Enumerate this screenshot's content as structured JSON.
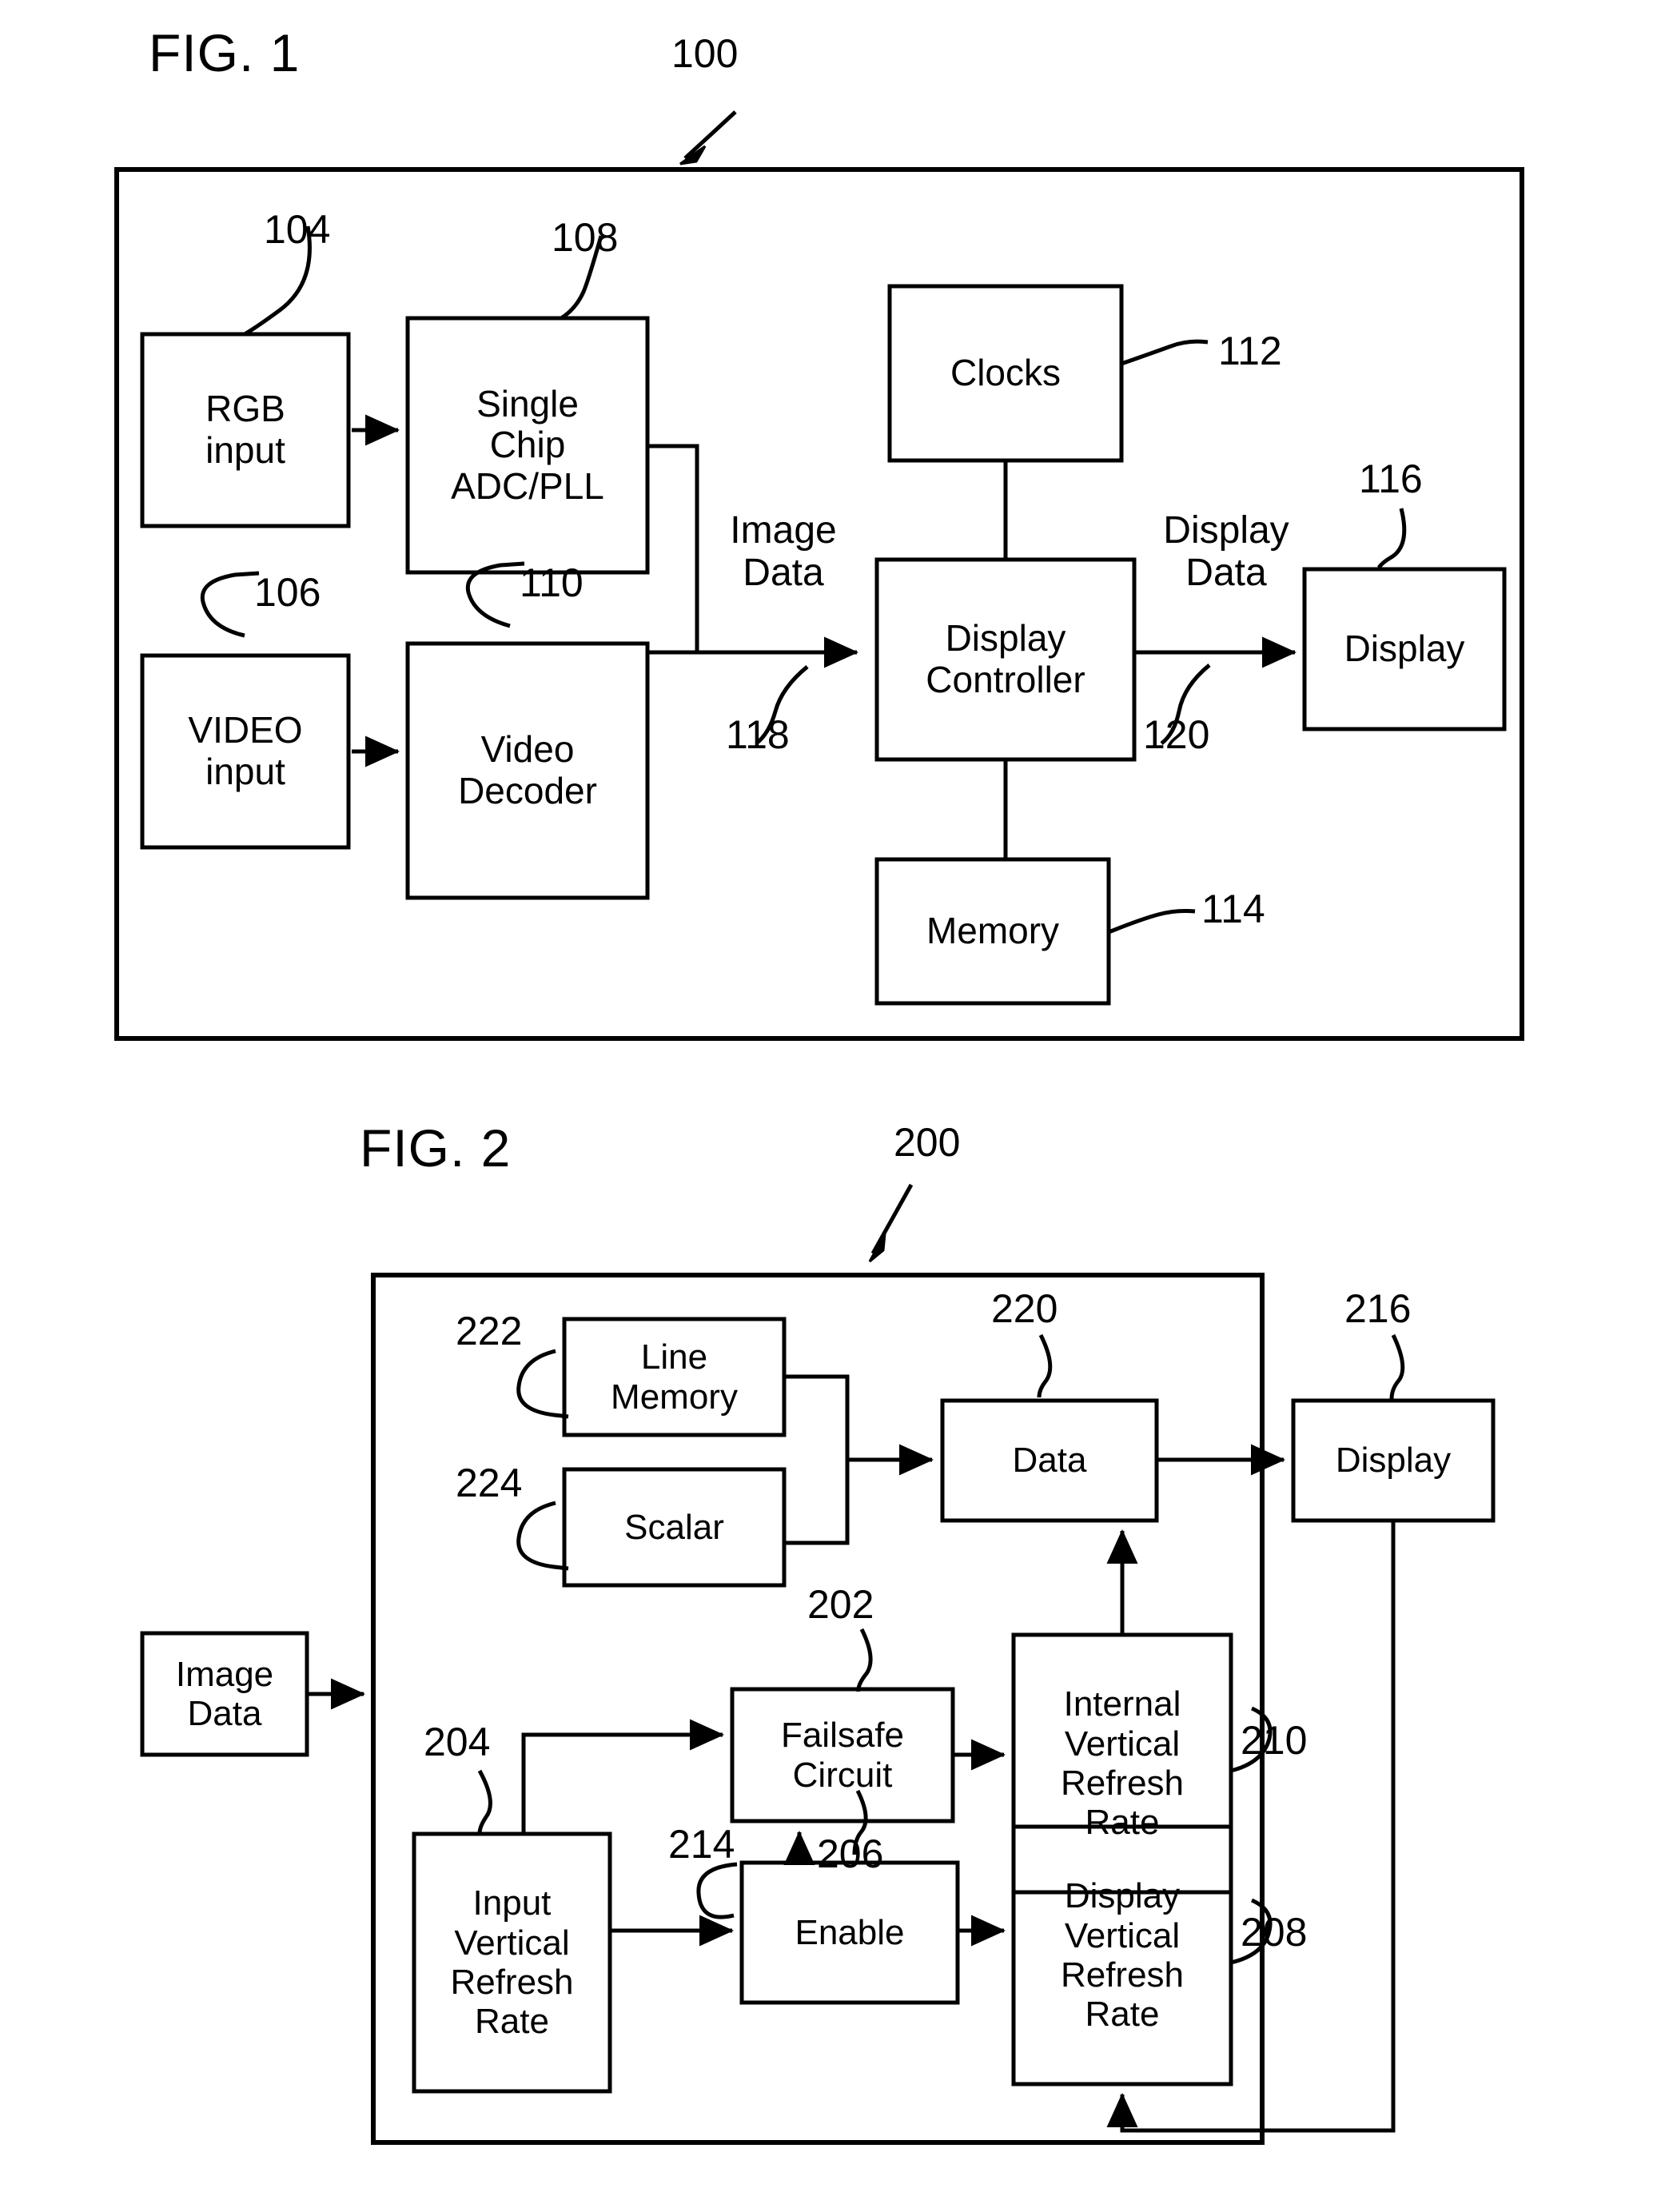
{
  "figures": [
    {
      "title": "FIG. 1",
      "ref": "100",
      "boxes": [
        {
          "label": "RGB\ninput",
          "ref": "104"
        },
        {
          "label": "Single\nChip\nADC/PLL",
          "ref": "108"
        },
        {
          "label": "VIDEO\ninput",
          "ref": "106"
        },
        {
          "label": "Video\nDecoder",
          "ref": "110"
        },
        {
          "label": "Clocks",
          "ref": "112"
        },
        {
          "label": "Display\nController",
          "ref": ""
        },
        {
          "label": "Memory",
          "ref": "114"
        },
        {
          "label": "Display",
          "ref": "116"
        }
      ],
      "edge_labels": [
        {
          "text": "Image\nData",
          "ref": "118"
        },
        {
          "text": "Display\nData",
          "ref": "120"
        }
      ]
    },
    {
      "title": "FIG. 2",
      "ref": "200",
      "boxes": [
        {
          "label": "Line\nMemory",
          "ref": "222"
        },
        {
          "label": "Scalar",
          "ref": "224"
        },
        {
          "label": "Data",
          "ref": "220"
        },
        {
          "label": "Display",
          "ref": "216"
        },
        {
          "label": "Failsafe\nCircuit",
          "ref": "202"
        },
        {
          "label": "Internal\nVertical\nRefresh\nRate",
          "ref": "210"
        },
        {
          "label": "Image\nData",
          "ref": ""
        },
        {
          "label": "Input\nVertical\nRefresh\nRate",
          "ref": "204"
        },
        {
          "label": "Enable",
          "ref": "206"
        },
        {
          "label": "Display\nVertical\nRefresh\nRate",
          "ref": "208"
        },
        {
          "label": "",
          "ref": "214"
        }
      ]
    }
  ],
  "fig1": {
    "title": "FIG. 1",
    "ref_system": "100",
    "rgb_input": "RGB\ninput",
    "rgb_input_ref": "104",
    "single_chip": "Single\nChip\nADC/PLL",
    "single_chip_ref": "108",
    "video_input": "VIDEO\ninput",
    "video_input_ref": "106",
    "video_decoder": "Video\nDecoder",
    "video_decoder_ref": "110",
    "clocks": "Clocks",
    "clocks_ref": "112",
    "display_controller": "Display\nController",
    "memory": "Memory",
    "memory_ref": "114",
    "display": "Display",
    "display_ref": "116",
    "image_data": "Image\nData",
    "image_data_ref": "118",
    "display_data": "Display\nData",
    "display_data_ref": "120"
  },
  "fig2": {
    "title": "FIG. 2",
    "ref_system": "200",
    "line_memory": "Line\nMemory",
    "line_memory_ref": "222",
    "scalar": "Scalar",
    "scalar_ref": "224",
    "data": "Data",
    "data_ref": "220",
    "display": "Display",
    "display_ref": "216",
    "failsafe_circuit": "Failsafe\nCircuit",
    "failsafe_circuit_ref": "202",
    "internal_vrr": "Internal\nVertical\nRefresh\nRate",
    "internal_vrr_ref": "210",
    "image_data": "Image\nData",
    "input_vrr": "Input\nVertical\nRefresh\nRate",
    "input_vrr_ref": "204",
    "enable": "Enable",
    "enable_ref": "206",
    "display_vrr": "Display\nVertical\nRefresh\nRate",
    "display_vrr_ref": "208",
    "enable_signal_ref": "214"
  },
  "colors": {
    "ink": "#000000",
    "paper": "#ffffff"
  }
}
